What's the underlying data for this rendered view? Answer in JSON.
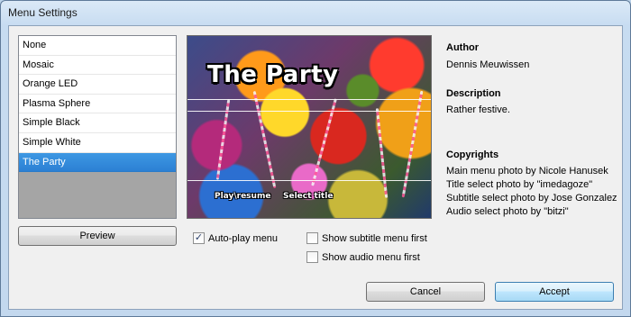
{
  "window": {
    "title": "Menu Settings"
  },
  "menus": {
    "items": [
      "None",
      "Mosaic",
      "Orange LED",
      "Plasma Sphere",
      "Simple Black",
      "Simple White",
      "The Party"
    ],
    "selected_index": 6
  },
  "preview_button": "Preview",
  "preview": {
    "title_text": "The Party",
    "play_link": "Play\\resume",
    "select_link": "Select title"
  },
  "info": {
    "author_heading": "Author",
    "author": "Dennis Meuwissen",
    "description_heading": "Description",
    "description": "Rather festive.",
    "copyrights_heading": "Copyrights",
    "copyrights": [
      "Main menu photo by Nicole Hanusek",
      "Title select photo by \"imedagoze\"",
      "Subtitle select photo by Jose Gonzalez",
      "Audio select photo by \"bitzi\""
    ]
  },
  "options": {
    "autoplay": {
      "label": "Auto-play menu",
      "checked": true
    },
    "subtitle_first": {
      "label": "Show subtitle menu first",
      "checked": false
    },
    "audio_first": {
      "label": "Show audio menu first",
      "checked": false
    }
  },
  "buttons": {
    "cancel": "Cancel",
    "accept": "Accept"
  }
}
